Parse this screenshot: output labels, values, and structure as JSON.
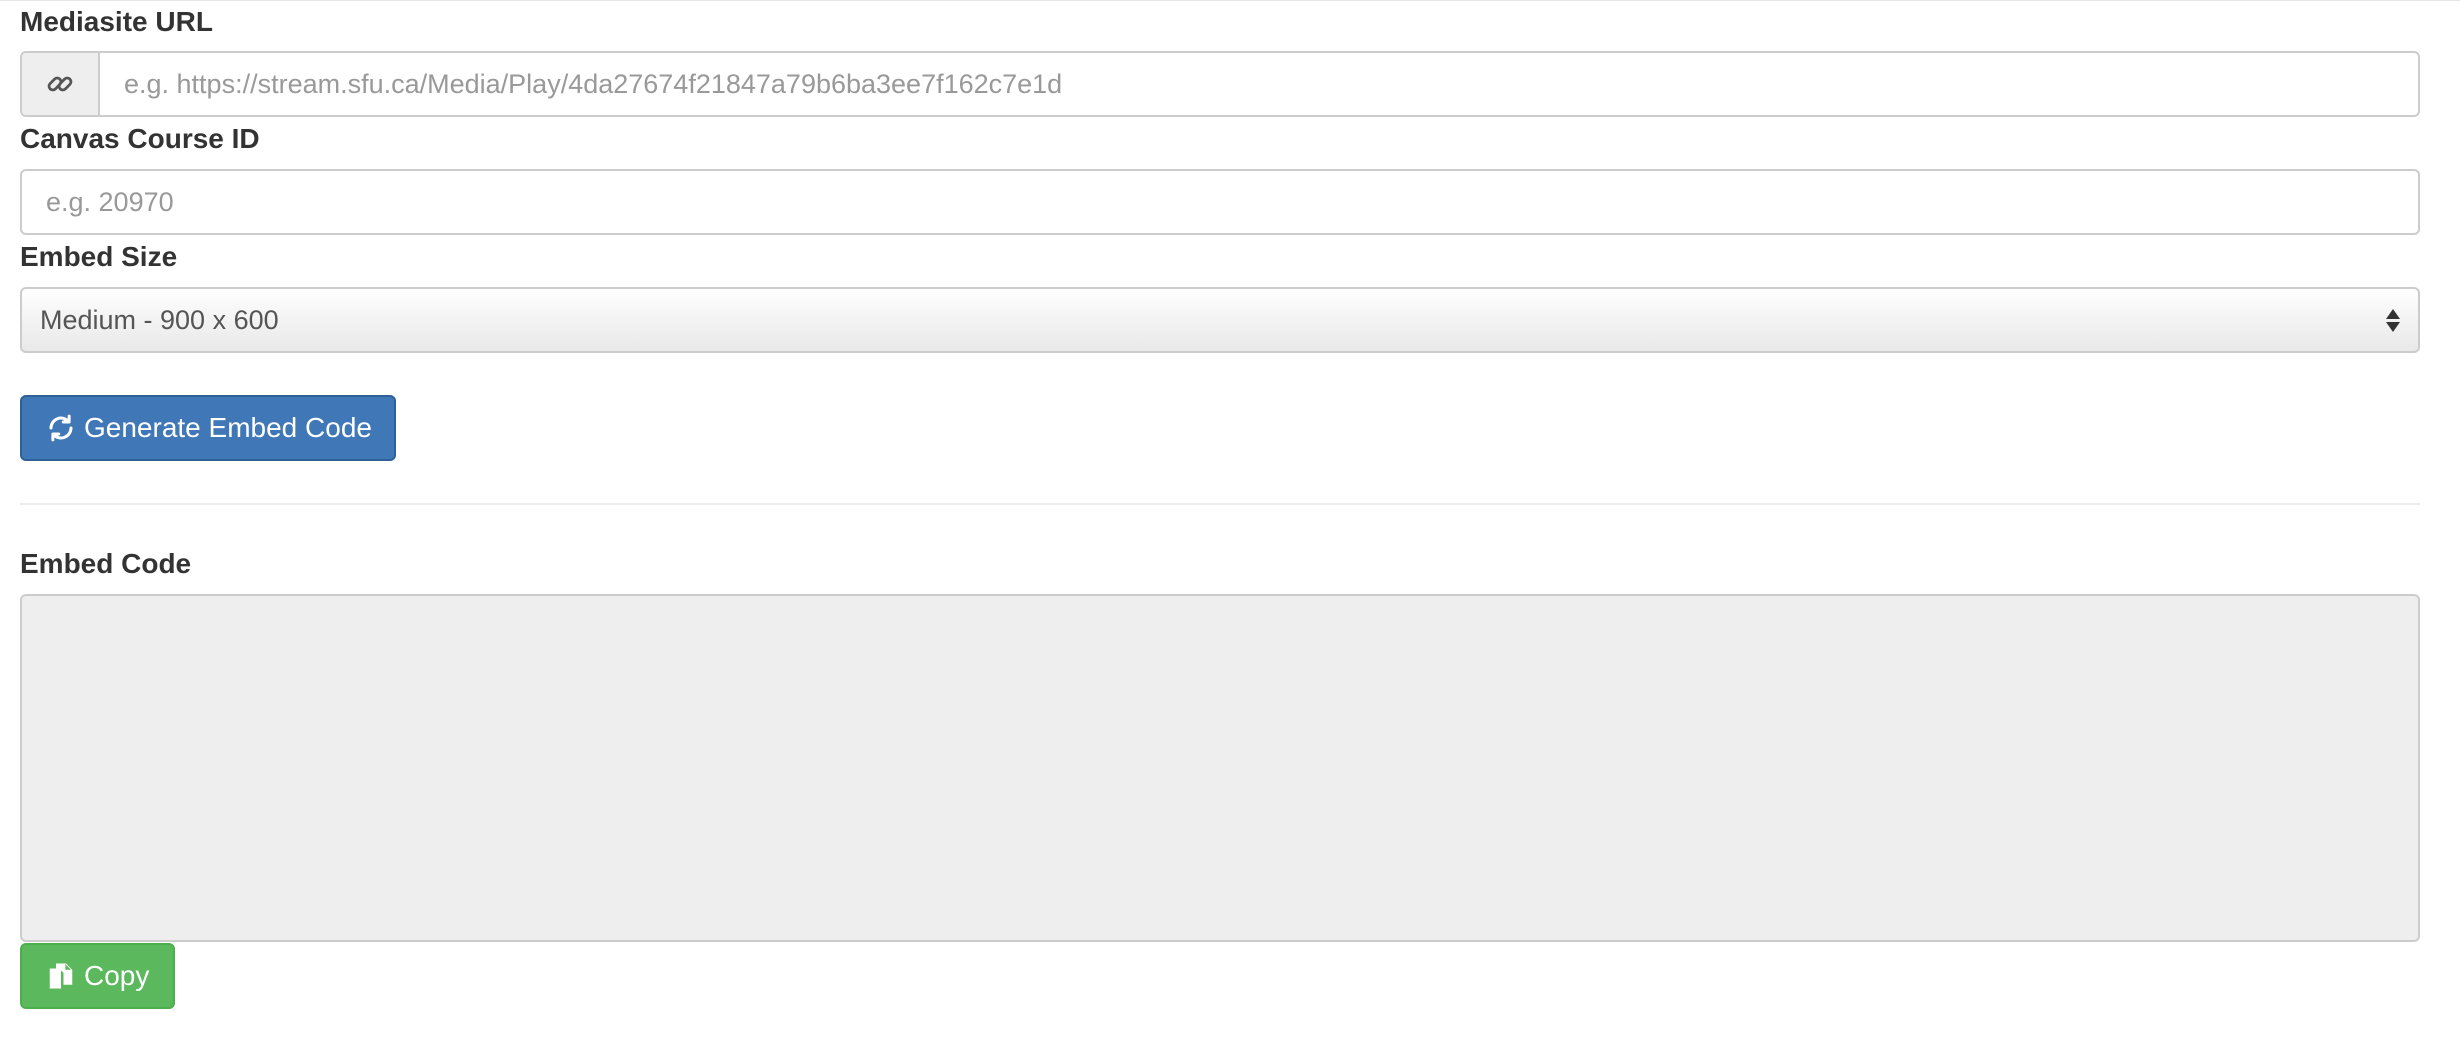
{
  "form": {
    "mediasite_url": {
      "label": "Mediasite URL",
      "placeholder": "e.g. https://stream.sfu.ca/Media/Play/4da27674f21847a79b6ba3ee7f162c7e1d",
      "value": "",
      "icon": "link-icon"
    },
    "canvas_course_id": {
      "label": "Canvas Course ID",
      "placeholder": "e.g. 20970",
      "value": ""
    },
    "embed_size": {
      "label": "Embed Size",
      "selected": "Medium - 900 x 600"
    },
    "generate_button": {
      "label": "Generate Embed Code",
      "icon": "refresh-icon",
      "color": "#4077b6"
    }
  },
  "output": {
    "embed_code": {
      "label": "Embed Code",
      "value": ""
    },
    "copy_button": {
      "label": "Copy",
      "icon": "copy-icon",
      "color": "#5cb85c"
    }
  }
}
